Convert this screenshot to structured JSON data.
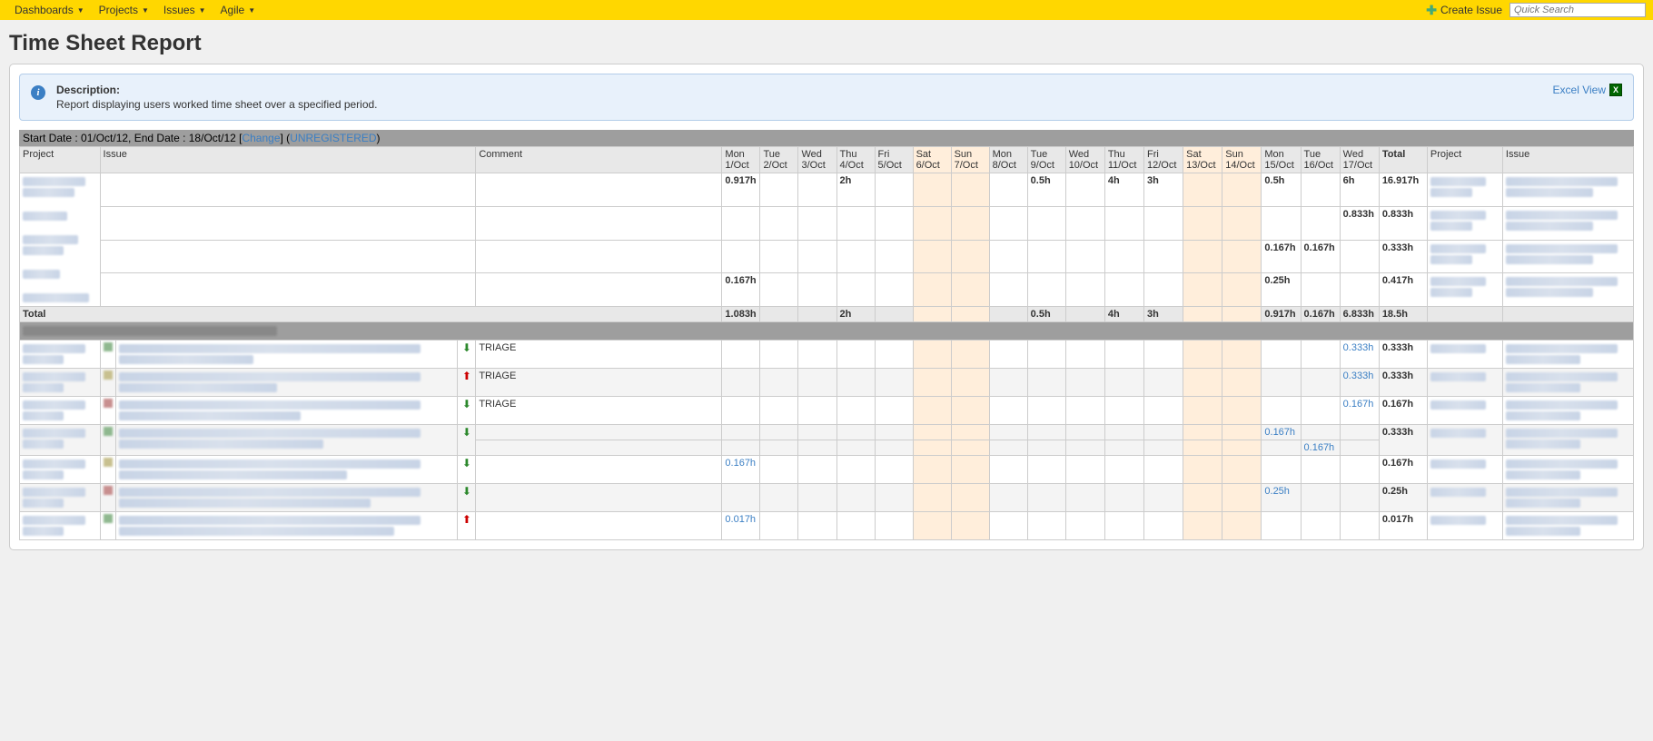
{
  "nav": {
    "items": [
      "Dashboards",
      "Projects",
      "Issues",
      "Agile"
    ],
    "create": "Create Issue",
    "search_placeholder": "Quick Search"
  },
  "page": {
    "title": "Time Sheet Report"
  },
  "info": {
    "title": "Description:",
    "desc": "Report displaying users worked time sheet over a specified period.",
    "excel": "Excel View"
  },
  "daterange": {
    "prefix": "Start Date : 01/Oct/12, End Date : 18/Oct/12 [",
    "change": "Change",
    "mid": "] (",
    "unreg": "UNREGISTERED",
    "suffix": ")"
  },
  "headers": {
    "project": "Project",
    "issue": "Issue",
    "comment": "Comment",
    "total": "Total",
    "days": [
      {
        "d": "Mon",
        "date": "1/Oct",
        "weekend": false
      },
      {
        "d": "Tue",
        "date": "2/Oct",
        "weekend": false
      },
      {
        "d": "Wed",
        "date": "3/Oct",
        "weekend": false
      },
      {
        "d": "Thu",
        "date": "4/Oct",
        "weekend": false
      },
      {
        "d": "Fri",
        "date": "5/Oct",
        "weekend": false
      },
      {
        "d": "Sat",
        "date": "6/Oct",
        "weekend": true
      },
      {
        "d": "Sun",
        "date": "7/Oct",
        "weekend": true
      },
      {
        "d": "Mon",
        "date": "8/Oct",
        "weekend": false
      },
      {
        "d": "Tue",
        "date": "9/Oct",
        "weekend": false
      },
      {
        "d": "Wed",
        "date": "10/Oct",
        "weekend": false
      },
      {
        "d": "Thu",
        "date": "11/Oct",
        "weekend": false
      },
      {
        "d": "Fri",
        "date": "12/Oct",
        "weekend": false
      },
      {
        "d": "Sat",
        "date": "13/Oct",
        "weekend": true
      },
      {
        "d": "Sun",
        "date": "14/Oct",
        "weekend": true
      },
      {
        "d": "Mon",
        "date": "15/Oct",
        "weekend": false
      },
      {
        "d": "Tue",
        "date": "16/Oct",
        "weekend": false
      },
      {
        "d": "Wed",
        "date": "17/Oct",
        "weekend": false
      }
    ]
  },
  "section1": {
    "rows": [
      {
        "days": [
          "0.917h",
          "",
          "",
          "2h",
          "",
          "",
          "",
          "",
          "0.5h",
          "",
          "4h",
          "3h",
          "",
          "",
          "0.5h",
          "",
          "6h"
        ],
        "total": "16.917h"
      },
      {
        "days": [
          "",
          "",
          "",
          "",
          "",
          "",
          "",
          "",
          "",
          "",
          "",
          "",
          "",
          "",
          "",
          "",
          "0.833h"
        ],
        "total": "0.833h"
      },
      {
        "days": [
          "",
          "",
          "",
          "",
          "",
          "",
          "",
          "",
          "",
          "",
          "",
          "",
          "",
          "",
          "0.167h",
          "0.167h",
          ""
        ],
        "total": "0.333h"
      },
      {
        "days": [
          "0.167h",
          "",
          "",
          "",
          "",
          "",
          "",
          "",
          "",
          "",
          "",
          "",
          "",
          "",
          "0.25h",
          "",
          ""
        ],
        "total": "0.417h"
      }
    ],
    "totals": {
      "label": "Total",
      "days": [
        "1.083h",
        "",
        "",
        "2h",
        "",
        "",
        "",
        "",
        "0.5h",
        "",
        "4h",
        "3h",
        "",
        "",
        "0.917h",
        "0.167h",
        "6.833h"
      ],
      "grand": "18.5h"
    }
  },
  "section2": {
    "rows": [
      {
        "priority": "down",
        "comment": "TRIAGE",
        "days": [
          "",
          "",
          "",
          "",
          "",
          "",
          "",
          "",
          "",
          "",
          "",
          "",
          "",
          "",
          "",
          "",
          "0.333h"
        ],
        "day_link": 16,
        "total": "0.333h",
        "alt": false
      },
      {
        "priority": "up",
        "comment": "TRIAGE",
        "days": [
          "",
          "",
          "",
          "",
          "",
          "",
          "",
          "",
          "",
          "",
          "",
          "",
          "",
          "",
          "",
          "",
          "0.333h"
        ],
        "day_link": 16,
        "total": "0.333h",
        "alt": true
      },
      {
        "priority": "down",
        "comment": "TRIAGE",
        "days": [
          "",
          "",
          "",
          "",
          "",
          "",
          "",
          "",
          "",
          "",
          "",
          "",
          "",
          "",
          "",
          "",
          "0.167h"
        ],
        "day_link": 16,
        "total": "0.167h",
        "alt": false
      },
      {
        "priority": "down",
        "comment": "",
        "days": [
          "",
          "",
          "",
          "",
          "",
          "",
          "",
          "",
          "",
          "",
          "",
          "",
          "",
          "",
          "0.167h",
          "",
          ""
        ],
        "day_link": 14,
        "total": "0.333h",
        "alt": true,
        "subrow": {
          "days": [
            "",
            "",
            "",
            "",
            "",
            "",
            "",
            "",
            "",
            "",
            "",
            "",
            "",
            "",
            "",
            "0.167h",
            ""
          ]
        }
      },
      {
        "priority": "down",
        "comment": "",
        "days": [
          "0.167h",
          "",
          "",
          "",
          "",
          "",
          "",
          "",
          "",
          "",
          "",
          "",
          "",
          "",
          "",
          "",
          ""
        ],
        "day_link": 0,
        "total": "0.167h",
        "alt": false
      },
      {
        "priority": "down",
        "comment": "",
        "days": [
          "",
          "",
          "",
          "",
          "",
          "",
          "",
          "",
          "",
          "",
          "",
          "",
          "",
          "",
          "0.25h",
          "",
          ""
        ],
        "day_link": 14,
        "total": "0.25h",
        "alt": true
      },
      {
        "priority": "up",
        "comment": "",
        "days": [
          "0.017h",
          "",
          "",
          "",
          "",
          "",
          "",
          "",
          "",
          "",
          "",
          "",
          "",
          "",
          "",
          "",
          ""
        ],
        "day_link": 0,
        "total": "0.017h",
        "alt": false
      }
    ]
  }
}
